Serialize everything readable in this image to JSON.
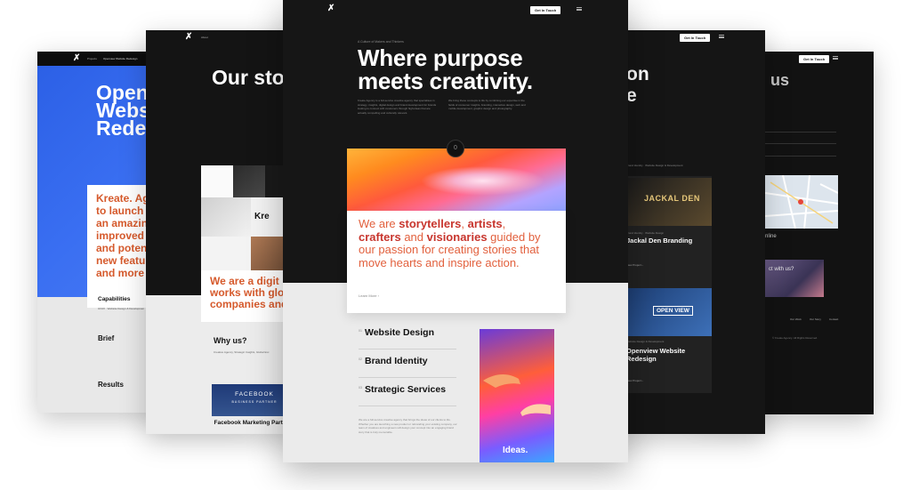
{
  "colors": {
    "accent": "#d65a2c",
    "blue": "#2b5fe5",
    "dark": "#161616"
  },
  "left_page": {
    "breadcrumb": [
      "Projects",
      "Openview Website Redesign"
    ],
    "title_lines": [
      "Openv",
      "Websi",
      "Redes"
    ],
    "card_lines": [
      "Kreate. Age",
      "to launch th",
      "an amazing",
      "improved th",
      "and potent",
      "new featur",
      "and more i"
    ],
    "capabilities_label": "Capabilities",
    "capabilities_text": "UI/UX · Website Design & Developmen",
    "brief": "Brief",
    "results": "Results"
  },
  "second_page": {
    "nav_label": "About",
    "title": "Our sto",
    "card_lines": [
      "We are a digit",
      "works with glo",
      "companies and"
    ],
    "kre": "Kre",
    "why": "Why us?",
    "why_sub": "Creative Agency, Strategic Insights, Global Exc",
    "fb_badge": "FACEBOOK",
    "fb_badge_sub": "BUSINESS PARTNER",
    "fb_caption": "Facebook Marketing Partners"
  },
  "center_page": {
    "logo": "✗",
    "cta": "Get In Touch",
    "eyebrow": "A Culture of Makers and Thinkers",
    "title_line1": "Where purpose",
    "title_line2": "meets creativity.",
    "intro_left": "Kreate Agency is a full-service creative agency that specialises in strategy, insights, digital design and brand development for brands looking to connect with customers through high-ideas that are actually compelling and culturally relevant.",
    "intro_right": "We bring these concepts to life by combining our expertise in the fields of consumer insights, branding, interactive design, web and mobile development, graphic design and photography.",
    "scroll_num": "0",
    "card_text": {
      "p1": "We are ",
      "w1": "storytellers",
      "p2": ", ",
      "w2": "artists",
      "p3": ", ",
      "w3": "crafters",
      "p4": " and ",
      "w4": "visionaries",
      "p5": " guided by our passion for creating stories that move hearts and inspire action."
    },
    "learn_more": "Learn More  ›",
    "services": [
      {
        "num": "01",
        "label": "Website Design"
      },
      {
        "num": "02",
        "label": "Brand Identity"
      },
      {
        "num": "03",
        "label": "Strategic Services"
      }
    ],
    "ideas_label": "Ideas.",
    "body_text": "We are a full-service creative agency that brings the ideas of our clients to life. Whether you are launching a new product or rebranding your existing company, our team of creatives and engineers will design your concept into an engaging brand story that is truly memorable."
  },
  "fourth_page": {
    "cta": "Get In Touch",
    "title_lines": [
      "on",
      "e"
    ],
    "meta": "Brand Identity · Website Design & Development",
    "project1_img": "JACKAL DEN",
    "project1_meta": "Brand Identity · Website Design",
    "project1_title": "Jackal Den Branding",
    "project1_link": "View Project  ›",
    "project2_img": "OPEN VIEW",
    "project2_meta": "Website Design & Development",
    "project2_title": "Openview Website Redesign",
    "project2_link": "View Project  ›"
  },
  "fifth_page": {
    "cta": "Get In Touch",
    "title": "th us",
    "online": "nline",
    "question": "ct with us?",
    "footer_links": [
      "Our Work",
      "Our Story",
      "Contact"
    ],
    "copyright": "© Kreate Agency. All Rights Reserved."
  }
}
